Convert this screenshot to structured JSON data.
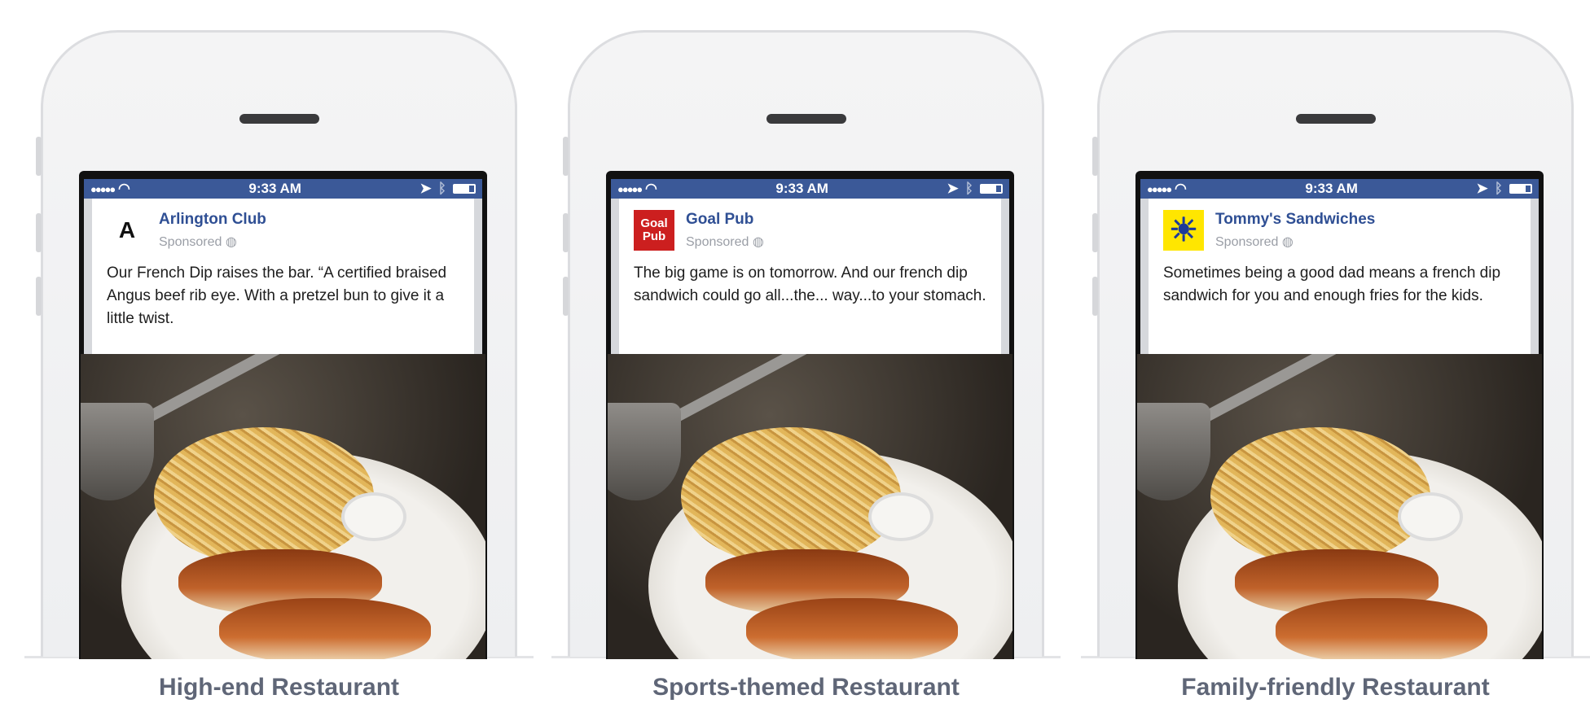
{
  "status_bar": {
    "time": "9:33 AM",
    "signal": "●●●●●",
    "icons": [
      "wifi-icon",
      "location-arrow-icon",
      "bluetooth-icon",
      "battery-icon"
    ]
  },
  "ads": [
    {
      "page_name": "Arlington Club",
      "sponsored": "Sponsored",
      "message": "Our French Dip raises the bar. “A certified braised Angus beef rib eye. With a pretzel bun to give it a little twist.",
      "caption": "High-end Restaurant",
      "logo_text": "A",
      "logo_bg": "#ffffff",
      "logo_color": "#111111"
    },
    {
      "page_name": "Goal Pub",
      "sponsored": "Sponsored",
      "message": "The big game is on tomorrow. And our french dip sandwich could go all...the... way...to your stomach.",
      "caption": "Sports-themed Restaurant",
      "logo_text": "Goal Pub",
      "logo_bg": "#cc1f1f",
      "logo_color": "#ffffff"
    },
    {
      "page_name": "Tommy's Sandwiches",
      "sponsored": "Sponsored",
      "message": "Sometimes being a good dad means a french dip sandwich for you and enough fries for the kids.",
      "caption": "Family-friendly Restaurant",
      "logo_text": "☀",
      "logo_bg": "#ffe600",
      "logo_color": "#1d3a9a"
    }
  ],
  "colors": {
    "facebook_blue": "#3b5998",
    "link_blue": "#2f4f94",
    "caption_gray": "#5f6677"
  }
}
